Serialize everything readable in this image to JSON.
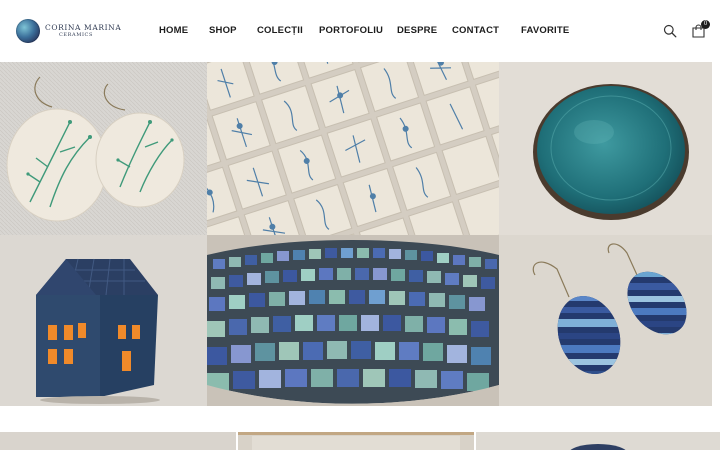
{
  "brand": {
    "name": "CORINA MARINA",
    "subtitle": "CERAMICS"
  },
  "nav": {
    "items": [
      {
        "label": "HOME"
      },
      {
        "label": "SHOP"
      },
      {
        "label": "COLECȚII"
      },
      {
        "label": "PORTOFOLIU"
      },
      {
        "label": "DESPRE"
      },
      {
        "label": "CONTACT"
      },
      {
        "label": "FAVORITE"
      }
    ]
  },
  "cart": {
    "count": "0"
  },
  "icons": {
    "search": "search-icon",
    "cart": "shopping-bag-icon"
  },
  "colors": {
    "text": "#1d1d1d",
    "accent_blue": "#2e4c7e",
    "teal": "#2b8e90"
  }
}
